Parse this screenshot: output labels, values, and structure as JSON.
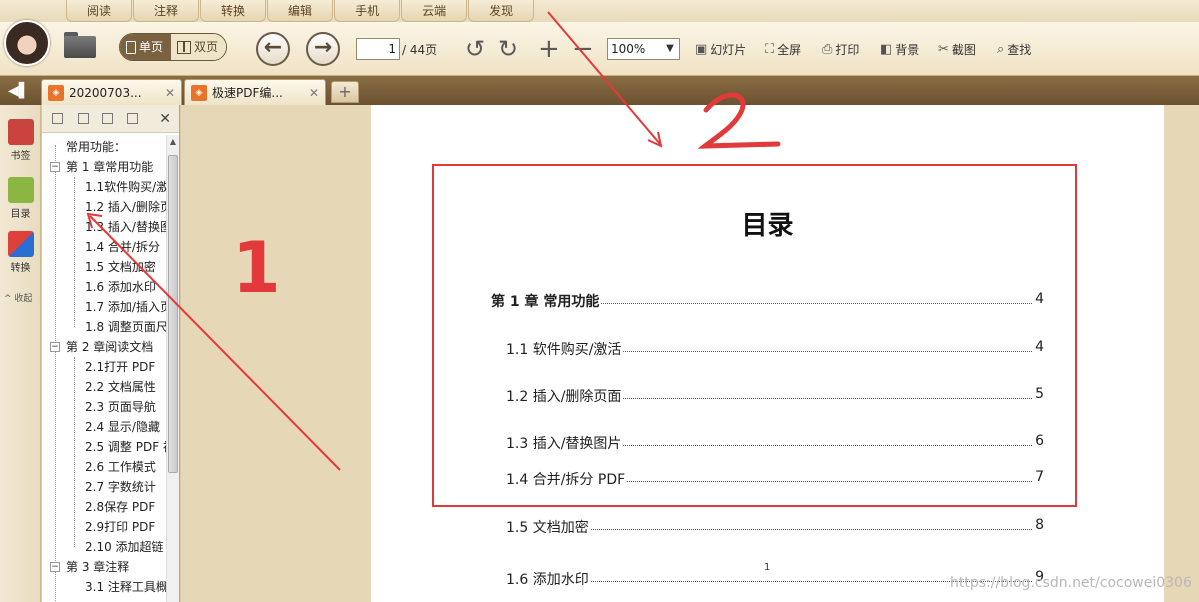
{
  "menu": {
    "tabs": [
      "阅读",
      "注释",
      "转换",
      "编辑",
      "手机",
      "云端",
      "发现"
    ]
  },
  "toolbar": {
    "single_page": "单页",
    "double_page": "双页",
    "page_current": "1",
    "page_total": "/ 44页",
    "zoom": "100%",
    "slideshow": "幻灯片",
    "fullscreen": "全屏",
    "print": "打印",
    "background": "背景",
    "screenshot": "截图",
    "find": "查找"
  },
  "tabs": [
    {
      "label": "20200703...",
      "active": false
    },
    {
      "label": "极速PDF编...",
      "active": true
    }
  ],
  "sidebar": {
    "bookmark": "书签",
    "toc": "目录",
    "convert": "转换",
    "collapse": "^ 收起"
  },
  "toc_tree": [
    {
      "label": "常用功能：",
      "level": 0
    },
    {
      "label": "第 1 章常用功能",
      "level": 1
    },
    {
      "label": "1.1软件购买/激",
      "level": 2
    },
    {
      "label": "1.2 插入/删除页",
      "level": 2
    },
    {
      "label": "1.3 插入/替换图",
      "level": 2
    },
    {
      "label": "1.4 合并/拆分",
      "level": 2
    },
    {
      "label": "1.5 文档加密",
      "level": 2
    },
    {
      "label": "1.6 添加水印",
      "level": 2
    },
    {
      "label": "1.7 添加/插入页",
      "level": 2
    },
    {
      "label": "1.8 调整页面尺",
      "level": 2
    },
    {
      "label": "第 2 章阅读文档",
      "level": 1
    },
    {
      "label": "2.1打开 PDF",
      "level": 2
    },
    {
      "label": "2.2 文档属性",
      "level": 2
    },
    {
      "label": "2.3 页面导航",
      "level": 2
    },
    {
      "label": "2.4 显示/隐藏",
      "level": 2
    },
    {
      "label": "2.5 调整 PDF 视",
      "level": 2
    },
    {
      "label": "2.6 工作模式",
      "level": 2
    },
    {
      "label": "2.7 字数统计",
      "level": 2
    },
    {
      "label": "2.8保存 PDF",
      "level": 2
    },
    {
      "label": "2.9打印 PDF",
      "level": 2
    },
    {
      "label": "2.10 添加超链",
      "level": 2
    },
    {
      "label": "第 3 章注释",
      "level": 1
    },
    {
      "label": "3.1 注释工具概",
      "level": 2
    }
  ],
  "document": {
    "title": "目录",
    "entries": [
      {
        "label": "第 1 章  常用功能",
        "page": "4",
        "bold": true
      },
      {
        "label": "1.1 软件购买/激活",
        "page": "4"
      },
      {
        "label": "1.2 插入/删除页面",
        "page": "5"
      },
      {
        "label": "1.3 插入/替换图片",
        "page": "6"
      },
      {
        "label": "1.4 合并/拆分 PDF",
        "page": "7"
      },
      {
        "label": "1.5 文档加密",
        "page": "8"
      },
      {
        "label": "1.6 添加水印",
        "page": "9"
      }
    ],
    "page_number": "1"
  },
  "annotations": {
    "label_1": "1",
    "label_2": "2"
  },
  "watermark": "https://blog.csdn.net/cocowei0306",
  "colors": {
    "annotation_red": "#e23a3a",
    "toolbar_brown": "#7a6240"
  }
}
